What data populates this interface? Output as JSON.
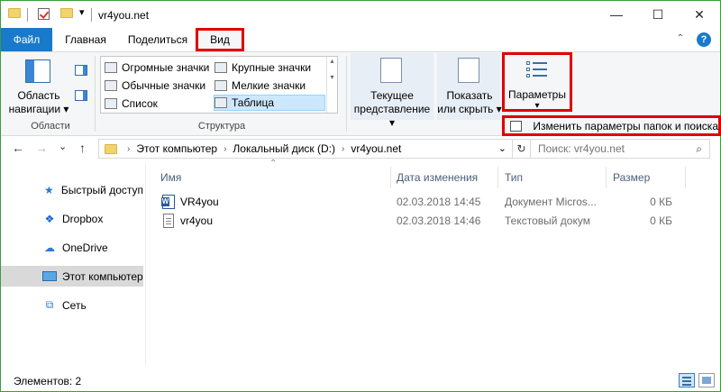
{
  "window": {
    "title": "vr4you.net",
    "minimize_glyph": "—",
    "maximize_glyph": "☐",
    "close_glyph": "✕",
    "frame_color": "#3b9d3b"
  },
  "quick_access": {
    "dropdown_glyph": "▾"
  },
  "ribbon_tabs": {
    "file": "Файл",
    "home": "Главная",
    "share": "Поделиться",
    "view": "Вид",
    "collapse_glyph": "⌃",
    "help_glyph": "?"
  },
  "ribbon": {
    "panes": {
      "nav_pane_line1": "Область",
      "nav_pane_line2": "навигации ▾",
      "group_label": "Области"
    },
    "layout": {
      "items": [
        "Огромные значки",
        "Крупные значки",
        "Обычные значки",
        "Мелкие значки",
        "Список",
        "Таблица"
      ],
      "selected": "Таблица",
      "group_label": "Структура"
    },
    "current_view": {
      "line1": "Текущее",
      "line2": "представление ▾"
    },
    "show_hide": {
      "line1": "Показать",
      "line2": "или скрыть ▾"
    },
    "options": {
      "label": "Параметры",
      "arrow": "▾",
      "menu_item": "Изменить параметры папок и поиска"
    }
  },
  "address": {
    "back_glyph": "←",
    "forward_glyph": "→",
    "recent_glyph": "⌄",
    "up_glyph": "↑",
    "crumbs": [
      "Этот компьютер",
      "Локальный диск (D:)",
      "vr4you.net"
    ],
    "crumb_sep": "›",
    "dropdown_glyph": "⌄",
    "refresh_glyph": "↻",
    "search_placeholder": "Поиск: vr4you.net",
    "search_glyph": "⌕"
  },
  "nav_pane": {
    "items": [
      {
        "label": "Быстрый доступ",
        "icon": "★"
      },
      {
        "label": "Dropbox",
        "icon": "❖"
      },
      {
        "label": "OneDrive",
        "icon": "☁"
      },
      {
        "label": "Этот компьютер",
        "icon": ""
      },
      {
        "label": "Сеть",
        "icon": "⧉"
      }
    ],
    "selected": "Этот компьютер"
  },
  "file_list": {
    "sort_glyph": "⌃",
    "columns": [
      "Имя",
      "Дата изменения",
      "Тип",
      "Размер"
    ],
    "rows": [
      {
        "name": "VR4you",
        "date": "02.03.2018 14:45",
        "type": "Документ Micros...",
        "size": "0 КБ",
        "icon": "word-icon"
      },
      {
        "name": "vr4you",
        "date": "02.03.2018 14:46",
        "type": "Текстовый докум",
        "size": "0 КБ",
        "icon": "text-file-icon"
      }
    ]
  },
  "status_bar": {
    "text": "Элементов: 2"
  },
  "colors": {
    "accent": "#1979ca",
    "highlight_red": "#e00000",
    "selection": "#cce8ff"
  }
}
